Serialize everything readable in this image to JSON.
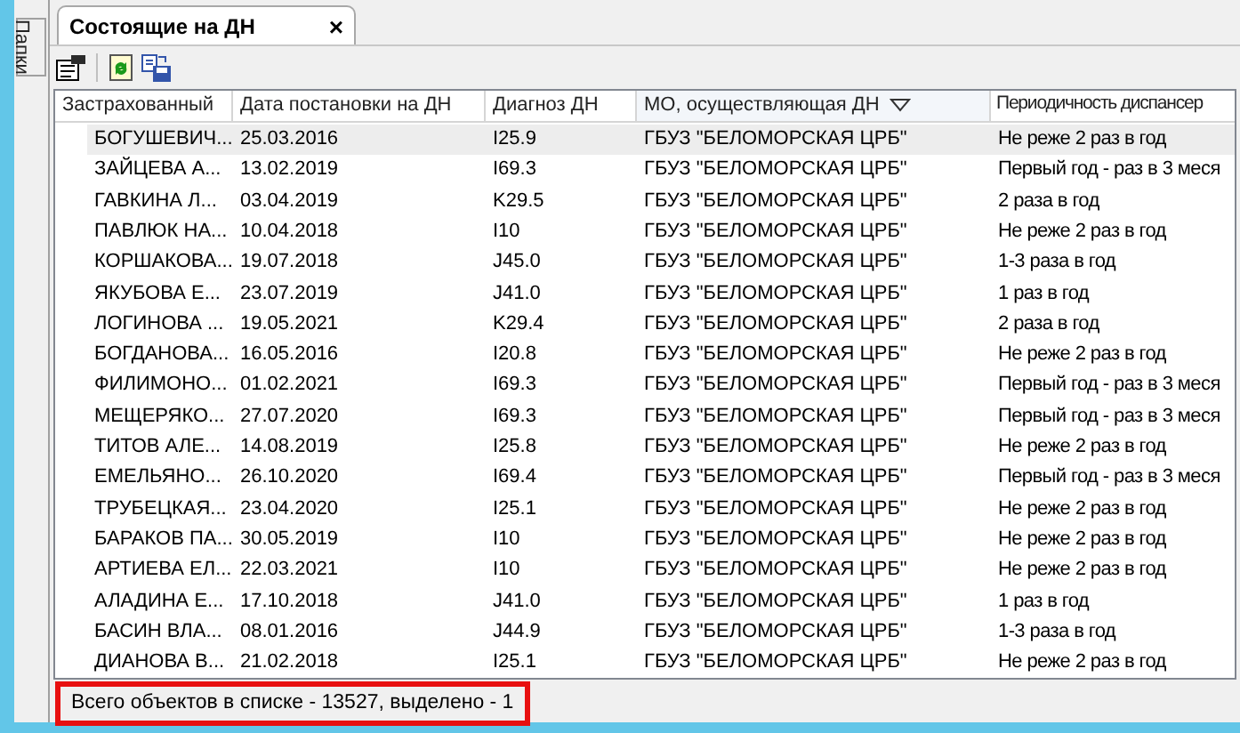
{
  "side_tab": {
    "label": "Папки"
  },
  "tab": {
    "title": "Состоящие на ДН",
    "close": "×"
  },
  "table": {
    "columns": [
      {
        "label": "Застрахованный",
        "sorted": false
      },
      {
        "label": "Дата постановки на ДН",
        "sorted": false
      },
      {
        "label": "Диагноз ДН",
        "sorted": false
      },
      {
        "label": "МО, осуществляющая ДН",
        "sorted": true
      },
      {
        "label": "Периодичность диспансер",
        "sorted": false
      }
    ],
    "rows": [
      {
        "selected": true,
        "cells": [
          "БОГУШЕВИЧ...",
          "25.03.2016",
          "I25.9",
          "ГБУЗ \"БЕЛОМОРСКАЯ ЦРБ\"",
          "Не реже 2 раз в год"
        ]
      },
      {
        "selected": false,
        "cells": [
          "ЗАЙЦЕВА А...",
          "13.02.2019",
          "I69.3",
          "ГБУЗ \"БЕЛОМОРСКАЯ ЦРБ\"",
          "Первый год - раз в 3 меся"
        ]
      },
      {
        "selected": false,
        "cells": [
          "ГАВКИНА Л...",
          "03.04.2019",
          "K29.5",
          "ГБУЗ \"БЕЛОМОРСКАЯ ЦРБ\"",
          "2 раза в год"
        ]
      },
      {
        "selected": false,
        "cells": [
          "ПАВЛЮК НА...",
          "10.04.2018",
          "I10",
          "ГБУЗ \"БЕЛОМОРСКАЯ ЦРБ\"",
          "Не реже 2 раз в год"
        ]
      },
      {
        "selected": false,
        "cells": [
          "КОРШАКОВА...",
          "19.07.2018",
          "J45.0",
          "ГБУЗ \"БЕЛОМОРСКАЯ ЦРБ\"",
          "1-3 раза в год"
        ]
      },
      {
        "selected": false,
        "cells": [
          "ЯКУБОВА Е...",
          "23.07.2019",
          "J41.0",
          "ГБУЗ \"БЕЛОМОРСКАЯ ЦРБ\"",
          "1 раз в год"
        ]
      },
      {
        "selected": false,
        "cells": [
          "ЛОГИНОВА ...",
          "19.05.2021",
          "K29.4",
          "ГБУЗ \"БЕЛОМОРСКАЯ ЦРБ\"",
          "2 раза в год"
        ]
      },
      {
        "selected": false,
        "cells": [
          "БОГДАНОВА...",
          "16.05.2016",
          "I20.8",
          "ГБУЗ \"БЕЛОМОРСКАЯ ЦРБ\"",
          "Не реже 2 раз в год"
        ]
      },
      {
        "selected": false,
        "cells": [
          "ФИЛИМОНО...",
          "01.02.2021",
          "I69.3",
          "ГБУЗ \"БЕЛОМОРСКАЯ ЦРБ\"",
          "Первый год - раз в 3 меся"
        ]
      },
      {
        "selected": false,
        "cells": [
          "МЕЩЕРЯКО...",
          "27.07.2020",
          "I69.3",
          "ГБУЗ \"БЕЛОМОРСКАЯ ЦРБ\"",
          "Первый год - раз в 3 меся"
        ]
      },
      {
        "selected": false,
        "cells": [
          "ТИТОВ АЛЕ...",
          "14.08.2019",
          "I25.8",
          "ГБУЗ \"БЕЛОМОРСКАЯ ЦРБ\"",
          "Не реже 2 раз в год"
        ]
      },
      {
        "selected": false,
        "cells": [
          "ЕМЕЛЬЯНО...",
          "26.10.2020",
          "I69.4",
          "ГБУЗ \"БЕЛОМОРСКАЯ ЦРБ\"",
          "Первый год - раз в 3 меся"
        ]
      },
      {
        "selected": false,
        "cells": [
          "ТРУБЕЦКАЯ...",
          "23.04.2020",
          "I25.1",
          "ГБУЗ \"БЕЛОМОРСКАЯ ЦРБ\"",
          "Не реже 2 раз в год"
        ]
      },
      {
        "selected": false,
        "cells": [
          "БАРАКОВ ПА...",
          "30.05.2019",
          "I10",
          "ГБУЗ \"БЕЛОМОРСКАЯ ЦРБ\"",
          "Не реже 2 раз в год"
        ]
      },
      {
        "selected": false,
        "cells": [
          "АРТИЕВА ЕЛ...",
          "22.03.2021",
          "I10",
          "ГБУЗ \"БЕЛОМОРСКАЯ ЦРБ\"",
          "Не реже 2 раз в год"
        ]
      },
      {
        "selected": false,
        "cells": [
          "АЛАДИНА Е...",
          "17.10.2018",
          "J41.0",
          "ГБУЗ \"БЕЛОМОРСКАЯ ЦРБ\"",
          "1 раз в год"
        ]
      },
      {
        "selected": false,
        "cells": [
          "БАСИН ВЛА...",
          "08.01.2016",
          "J44.9",
          "ГБУЗ \"БЕЛОМОРСКАЯ ЦРБ\"",
          "1-3 раза в год"
        ]
      },
      {
        "selected": false,
        "cells": [
          "ДИАНОВА В...",
          "21.02.2018",
          "I25.1",
          "ГБУЗ \"БЕЛОМОРСКАЯ ЦРБ\"",
          "Не реже 2 раз в год"
        ]
      }
    ]
  },
  "status_bar": {
    "text": "Всего объектов в списке - 13527, выделено - 1"
  }
}
